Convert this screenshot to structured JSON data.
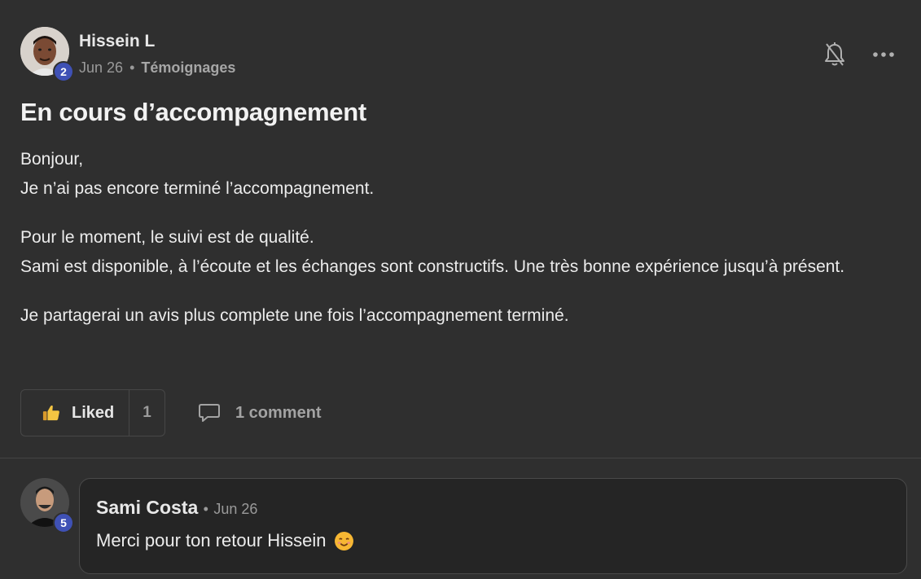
{
  "post": {
    "author": {
      "name": "Hissein L",
      "level": "2"
    },
    "date": "Jun 26",
    "separator": "•",
    "category": "Témoignages",
    "title": "En cours d’accompagnement",
    "paragraphs": [
      "Bonjour,",
      "Je n’ai pas encore terminé l’accompagnement.",
      "Pour le moment, le suivi est de qualité.",
      "Sami est disponible, à l’écoute et les échanges sont constructifs. Une très bonne expérience jusqu’à présent.",
      "Je partagerai un avis plus complete une fois l’accompagnement terminé."
    ],
    "actions": {
      "like_label": "Liked",
      "like_count": "1",
      "comment_label": "1 comment"
    }
  },
  "comment": {
    "author": {
      "name": "Sami Costa",
      "level": "5"
    },
    "separator": "•",
    "date": "Jun 26",
    "text": "Merci pour ton retour Hissein"
  },
  "icons": {
    "bell": "bell-muted-icon",
    "more": "more-horizontal-icon",
    "like": "thumbs-up-icon",
    "comment": "comment-bubble-icon",
    "emoji": "smiling-face-icon"
  },
  "colors": {
    "background": "#2f2f2f",
    "badge": "#3f51b5",
    "comment_background": "#252525"
  }
}
